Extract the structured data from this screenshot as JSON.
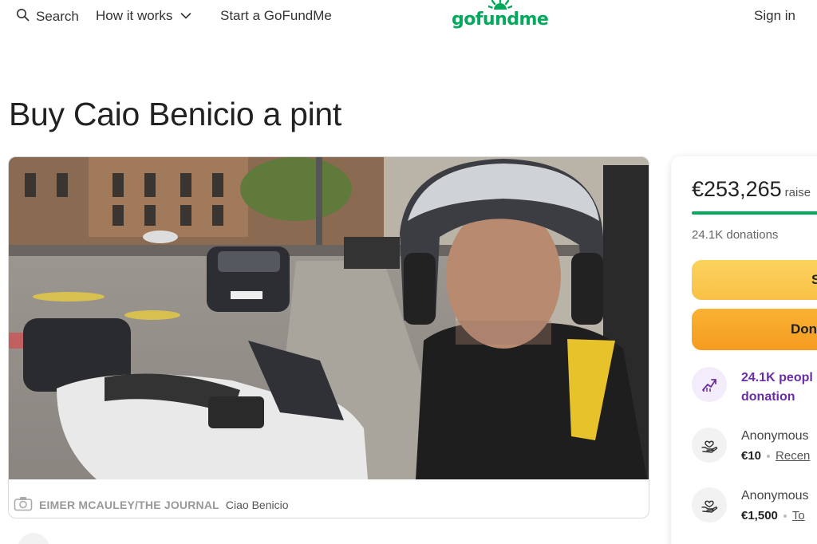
{
  "header": {
    "search_label": "Search",
    "how_it_works_label": "How it works",
    "start_label": "Start a GoFundMe",
    "logo_text": "gofundme",
    "signin_label": "Sign in",
    "brand_color": "#02a95c"
  },
  "campaign": {
    "title": "Buy Caio Benicio a pint",
    "caption_credit": "EIMER MCAULEY/THE JOURNAL",
    "caption_text": "Ciao Benicio"
  },
  "sidebar": {
    "raised_amount": "€253,265",
    "raised_label": "raise",
    "progress": 1.0,
    "donations_count": "24.1K donations",
    "share_label": "S",
    "donate_label": "Don",
    "highlight_line1": "24.1K peopl",
    "highlight_line2": "donation",
    "donations": [
      {
        "name": "Anonymous",
        "amount": "€10",
        "tag": "Recen"
      },
      {
        "name": "Anonymous",
        "amount": "€1,500",
        "tag": "To"
      }
    ]
  }
}
